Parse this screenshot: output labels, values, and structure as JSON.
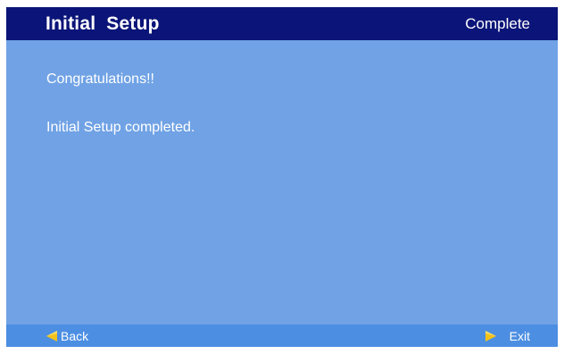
{
  "header": {
    "title": "Initial  Setup",
    "status": "Complete"
  },
  "content": {
    "message1": "Congratulations!!",
    "message2": "Initial Setup completed."
  },
  "footer": {
    "back_label": "Back",
    "exit_label": "Exit",
    "back_icon": "arrow-left-icon",
    "exit_icon": "arrow-right-icon"
  },
  "colors": {
    "header_bg": "#0b1478",
    "content_bg": "#70a2e5",
    "footer_bg": "#4c8ee2",
    "arrow": "#f2c21b"
  }
}
